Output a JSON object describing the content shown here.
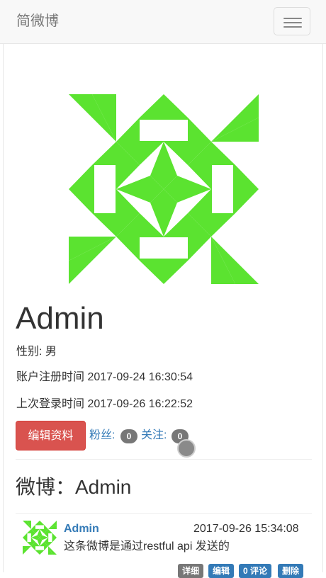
{
  "navbar": {
    "brand": "简微博",
    "menu_icon": "hamburger-icon"
  },
  "profile": {
    "username": "Admin",
    "gender": "性别: 男",
    "registered": "账户注册时间 2017-09-24 16:30:54",
    "last_login": "上次登录时间 2017-09-26 16:22:52",
    "edit_button": "编辑资料",
    "followers_label": "粉丝:",
    "followers_count": "0",
    "following_label": "关注:",
    "following_count": "0",
    "avatar_color": "#5be330"
  },
  "posts_section": {
    "title": "微博：Admin",
    "posts": [
      {
        "author": "Admin",
        "time": "2017-09-26 15:34:08",
        "body": "这条微博是通过restful api 发送的",
        "actions": [
          "详细",
          "编辑",
          "0 评论",
          "删除"
        ]
      }
    ]
  },
  "colors": {
    "primary": "#337ab7",
    "danger": "#d9534f",
    "badge": "#777777"
  }
}
